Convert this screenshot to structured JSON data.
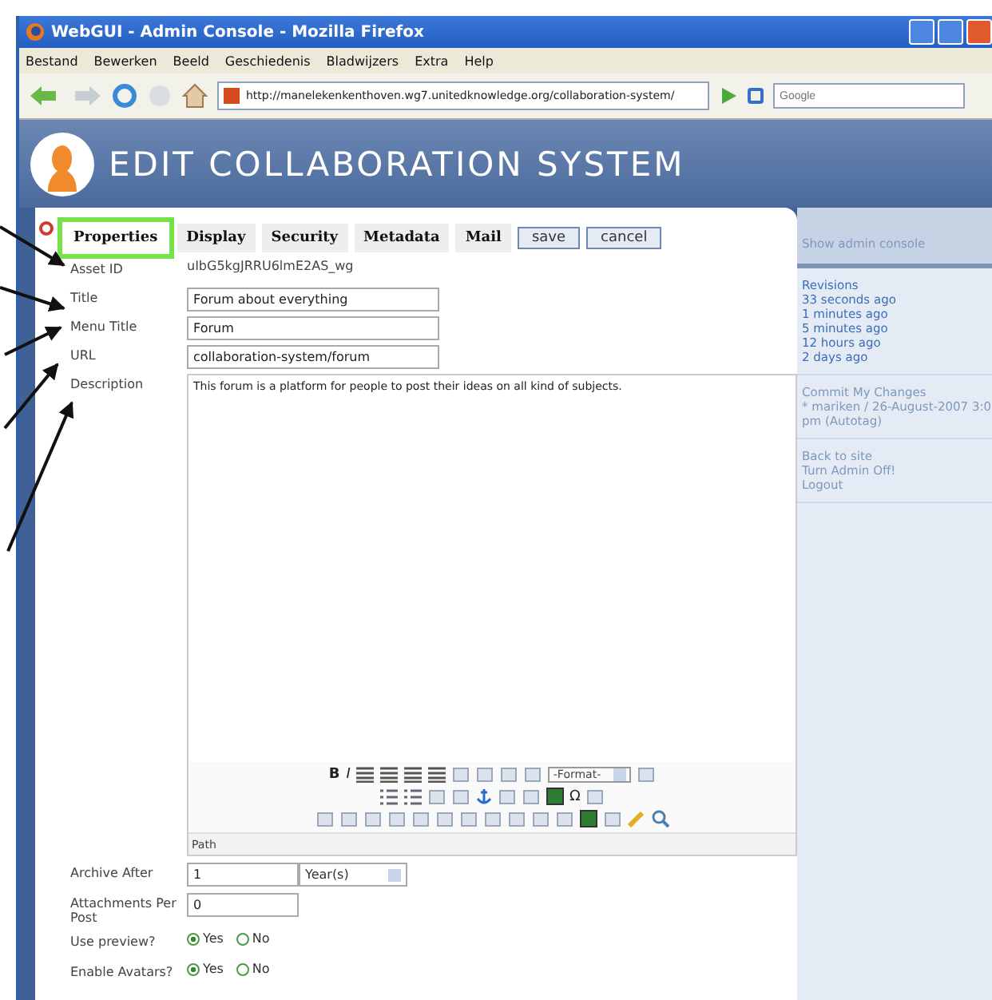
{
  "window": {
    "title": "WebGUI - Admin Console - Mozilla Firefox"
  },
  "menu": [
    "Bestand",
    "Bewerken",
    "Beeld",
    "Geschiedenis",
    "Bladwijzers",
    "Extra",
    "Help"
  ],
  "address": {
    "value": "http://manelekenkenthoven.wg7.unitedknowledge.org/collaboration-system/"
  },
  "search": {
    "placeholder": "Google"
  },
  "page_title": "EDIT COLLABORATION SYSTEM",
  "tabs": [
    {
      "label": "Properties",
      "selected": true
    },
    {
      "label": "Display",
      "selected": false
    },
    {
      "label": "Security",
      "selected": false
    },
    {
      "label": "Metadata",
      "selected": false
    },
    {
      "label": "Mail",
      "selected": false
    }
  ],
  "actions": [
    "save",
    "cancel"
  ],
  "fields": [
    {
      "label": "Asset ID",
      "kind": "text",
      "value": "uIbG5kgJRRU6lmE2AS_wg"
    },
    {
      "label": "Title",
      "kind": "input",
      "value": "Forum about everything"
    },
    {
      "label": "Menu Title",
      "kind": "input",
      "value": "Forum"
    },
    {
      "label": "URL",
      "kind": "input",
      "value": "collaboration-system/forum"
    },
    {
      "label": "Description",
      "kind": "editor",
      "value": "This forum is a platform for people to post their ideas on all kind of subjects."
    }
  ],
  "editor": {
    "bold": "B",
    "italic": "I",
    "format": "-Format-",
    "omega": "Ω",
    "path": "Path"
  },
  "options": [
    {
      "label": "Archive After",
      "kind": "period",
      "value": "1",
      "unit": "Year(s)"
    },
    {
      "label": "Attachments Per Post",
      "kind": "input",
      "value": "0"
    },
    {
      "label": "Use preview?",
      "kind": "radio",
      "choices": [
        {
          "label": "Yes",
          "selected": true
        },
        {
          "label": "No",
          "selected": false
        }
      ]
    },
    {
      "label": "Enable Avatars?",
      "kind": "radio",
      "choices": [
        {
          "label": "Yes",
          "selected": true
        },
        {
          "label": "No",
          "selected": false
        }
      ]
    }
  ],
  "sidebar": {
    "show_console": "Show admin console",
    "sections": [
      [
        "Revisions",
        "33 seconds ago",
        "1 minutes ago",
        "5 minutes ago",
        "12 hours ago",
        "2 days ago"
      ],
      [
        "Commit My Changes",
        "* mariken / 26-August-2007 3:0",
        "pm (Autotag)"
      ],
      [
        "Back to site",
        "Turn Admin Off!",
        "Logout"
      ]
    ]
  }
}
